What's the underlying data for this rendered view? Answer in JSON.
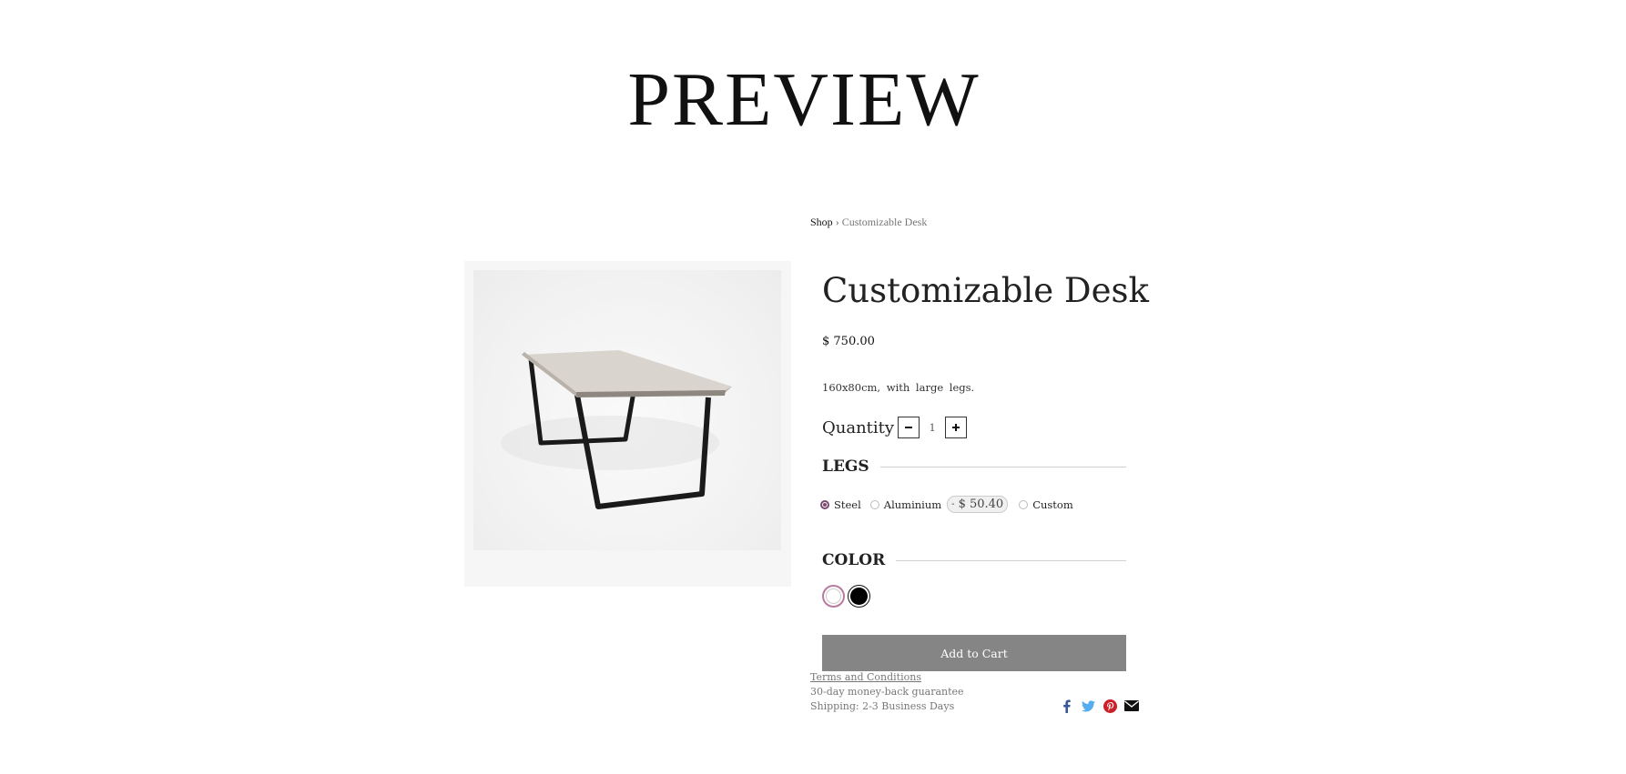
{
  "header": {
    "title": "PREVIEW"
  },
  "breadcrumb": {
    "shop": "Shop",
    "separator": "›",
    "current": "Customizable Desk"
  },
  "product": {
    "name": "Customizable Desk",
    "price": "$ 750.00",
    "description": "160x80cm, with large legs.",
    "quantity_label": "Quantity",
    "quantity_value": "1",
    "minus_icon": "minus-icon",
    "plus_icon": "plus-icon"
  },
  "legs": {
    "heading": "LEGS",
    "options": [
      {
        "label": "Steel",
        "selected": true
      },
      {
        "label": "Aluminium",
        "selected": false
      },
      {
        "label": "Custom",
        "selected": false
      }
    ],
    "extra_price_sign": "-",
    "extra_price": "$ 50.40"
  },
  "color": {
    "heading": "COLOR",
    "swatches": [
      {
        "name": "White",
        "hex": "#ffffff",
        "selected": true
      },
      {
        "name": "Black",
        "hex": "#000000",
        "selected": false
      }
    ]
  },
  "cart": {
    "button_label": "Add to Cart",
    "button_color": "#858585"
  },
  "info": {
    "terms": "Terms and Conditions",
    "guarantee": "30-day money-back guarantee",
    "shipping": "Shipping: 2-3 Business Days"
  },
  "share": {
    "icons": [
      "facebook-icon",
      "twitter-icon",
      "pinterest-icon",
      "envelope-icon"
    ],
    "colors": {
      "facebook": "#3b5998",
      "twitter": "#55acee",
      "pinterest": "#cb2027",
      "email": "#111111"
    }
  }
}
